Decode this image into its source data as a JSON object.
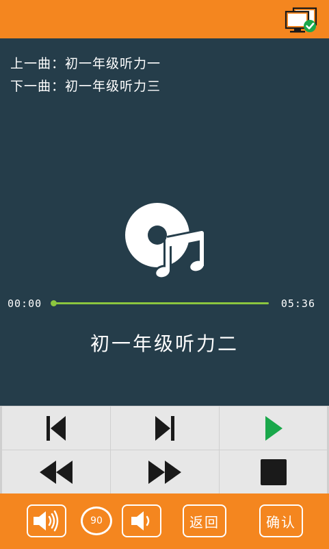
{
  "header": {
    "status_icon": "monitor-connected-icon",
    "colors": {
      "bar": "#f4861f",
      "check": "#1aa84b"
    }
  },
  "playlist": {
    "previous": "上一曲：初一年级听力一",
    "next": "下一曲：初一年级听力三"
  },
  "player": {
    "disc_icon": "disc-music-icon",
    "current_time": "00:00",
    "total_time": "05:36",
    "progress": 0,
    "now_playing": "初一年级听力二",
    "colors": {
      "background": "#253d4a",
      "progress": "#8cc63f"
    }
  },
  "controls": {
    "row1": [
      "skip-previous-icon",
      "skip-next-icon",
      "play-icon"
    ],
    "row2": [
      "rewind-icon",
      "fast-forward-icon",
      "stop-icon"
    ],
    "colors": {
      "play": "#1aa84b",
      "glyph": "#1a1a1a"
    }
  },
  "footer": {
    "volume_up_icon": "volume-up-icon",
    "volume_level": "90",
    "volume_down_icon": "volume-down-icon",
    "back_label": "返回",
    "confirm_label": "确认"
  }
}
